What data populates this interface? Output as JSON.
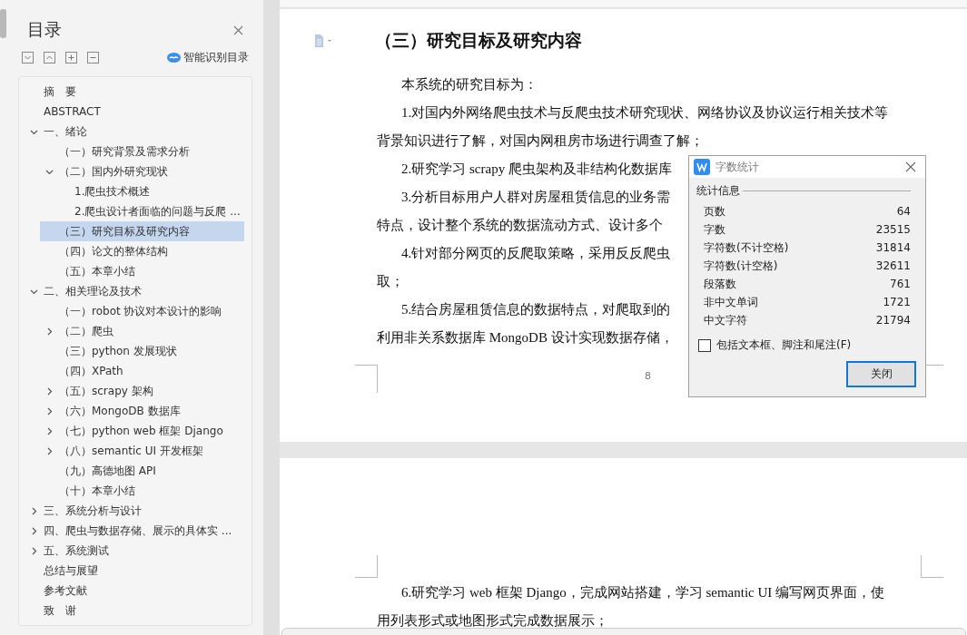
{
  "sidebar": {
    "title": "目录",
    "smart_toc": "智能识别目录",
    "tree": [
      {
        "label": "摘　要",
        "selected": false
      },
      {
        "label": "ABSTRACT",
        "selected": false
      },
      {
        "label": "一、绪论",
        "selected": false,
        "expanded": true,
        "children": [
          {
            "label": "（一）研究背景及需求分析",
            "selected": false
          },
          {
            "label": "（二）国内外研究现状",
            "selected": false,
            "expanded": true,
            "children": [
              {
                "label": "1.爬虫技术概述",
                "selected": false
              },
              {
                "label": "2.爬虫设计者面临的问题与反爬 ...",
                "selected": false
              }
            ]
          },
          {
            "label": "（三）研究目标及研究内容",
            "selected": true
          },
          {
            "label": "（四）论文的整体结构",
            "selected": false
          },
          {
            "label": "（五）本章小结",
            "selected": false
          }
        ]
      },
      {
        "label": "二、相关理论及技术",
        "selected": false,
        "expanded": true,
        "children": [
          {
            "label": "（一）robot 协议对本设计的影响",
            "selected": false
          },
          {
            "label": "（二）爬虫",
            "selected": false,
            "expanded": false
          },
          {
            "label": "（三）python 发展现状",
            "selected": false
          },
          {
            "label": "（四）XPath",
            "selected": false
          },
          {
            "label": "（五）scrapy 架构",
            "selected": false,
            "expanded": false
          },
          {
            "label": "（六）MongoDB 数据库",
            "selected": false,
            "expanded": false
          },
          {
            "label": "（七）python web 框架 Django",
            "selected": false,
            "expanded": false
          },
          {
            "label": "（八）semantic UI 开发框架",
            "selected": false,
            "expanded": false
          },
          {
            "label": "（九）高德地图 API",
            "selected": false
          },
          {
            "label": "（十）本章小结",
            "selected": false
          }
        ]
      },
      {
        "label": "三、系统分析与设计",
        "selected": false,
        "expanded": false
      },
      {
        "label": "四、爬虫与数据存储、展示的具体实 ...",
        "selected": false,
        "expanded": false
      },
      {
        "label": "五、系统测试",
        "selected": false,
        "expanded": false
      },
      {
        "label": "总结与展望",
        "selected": false
      },
      {
        "label": "参考文献",
        "selected": false
      },
      {
        "label": "致　谢",
        "selected": false
      }
    ]
  },
  "document": {
    "pages": [
      {
        "heading": "（三）研究目标及研究内容",
        "page_number": "8",
        "paragraphs": [
          [
            "本系统的研究目标为："
          ],
          [
            "1.对国内外网络爬虫技术与反爬虫技术研究现状、网络协议及协议运行相关技术等",
            "背景知识进行了解，对国内网租房市场进行调查了解；"
          ],
          [
            "2.研究学习 scrapy 爬虫架构及非结构化数据库"
          ],
          [
            "3.分析目标用户人群对房屋租赁信息的业务需",
            "特点，设计整个系统的数据流动方式、设计多个"
          ],
          [
            "4.针对部分网页的反爬取策略，采用反反爬虫",
            "取；"
          ],
          [
            "5.结合房屋租赁信息的数据特点，对爬取到的",
            "利用非关系数据库 MongoDB 设计实现数据存储，"
          ]
        ]
      },
      {
        "paragraphs": [
          [
            "6.研究学习 web 框架 Django，完成网站搭建，学习 semantic UI 编写网页界面，使",
            "用列表形式或地图形式完成数据展示；"
          ]
        ]
      }
    ]
  },
  "dialog": {
    "title": "字数统计",
    "section": "统计信息",
    "stats": [
      {
        "label": "页数",
        "value": "64"
      },
      {
        "label": "字数",
        "value": "23515"
      },
      {
        "label": "字符数(不计空格)",
        "value": "31814"
      },
      {
        "label": "字符数(计空格)",
        "value": "32611"
      },
      {
        "label": "段落数",
        "value": "761"
      },
      {
        "label": "非中文单词",
        "value": "1721"
      },
      {
        "label": "中文字符",
        "value": "21794"
      }
    ],
    "include_option": {
      "label": "包括文本框、脚注和尾注(F)",
      "checked": false
    },
    "button": "关闭"
  }
}
